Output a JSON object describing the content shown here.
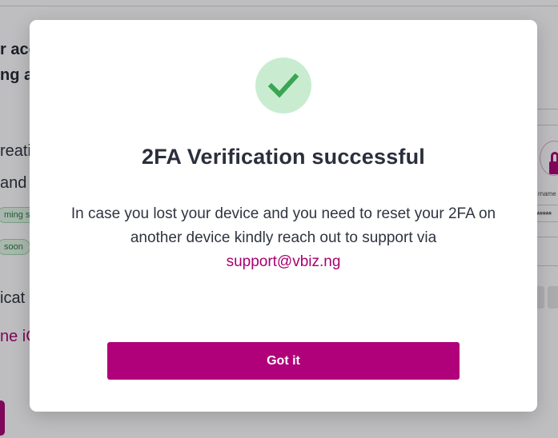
{
  "background": {
    "heading_line1": "r acc",
    "heading_line2": "ng a",
    "text_line1": "reatio",
    "text_line2": "and",
    "badge_1": "ming so",
    "badge_2": "soon",
    "text_line3": "icat",
    "link_text": "ne iC",
    "illustration": {
      "caption": "rname",
      "password_mask": "*****"
    }
  },
  "modal": {
    "title": "2FA Verification successful",
    "body_text": "In case you lost your device and you need to reset your 2FA on another device kindly reach out to support via",
    "support_email": "support@vbiz.ng",
    "button_label": "Got it",
    "icon": "check-icon",
    "colors": {
      "accent": "#b0007a",
      "success_bg": "#c9ecd0",
      "success_check": "#3aa552"
    }
  }
}
